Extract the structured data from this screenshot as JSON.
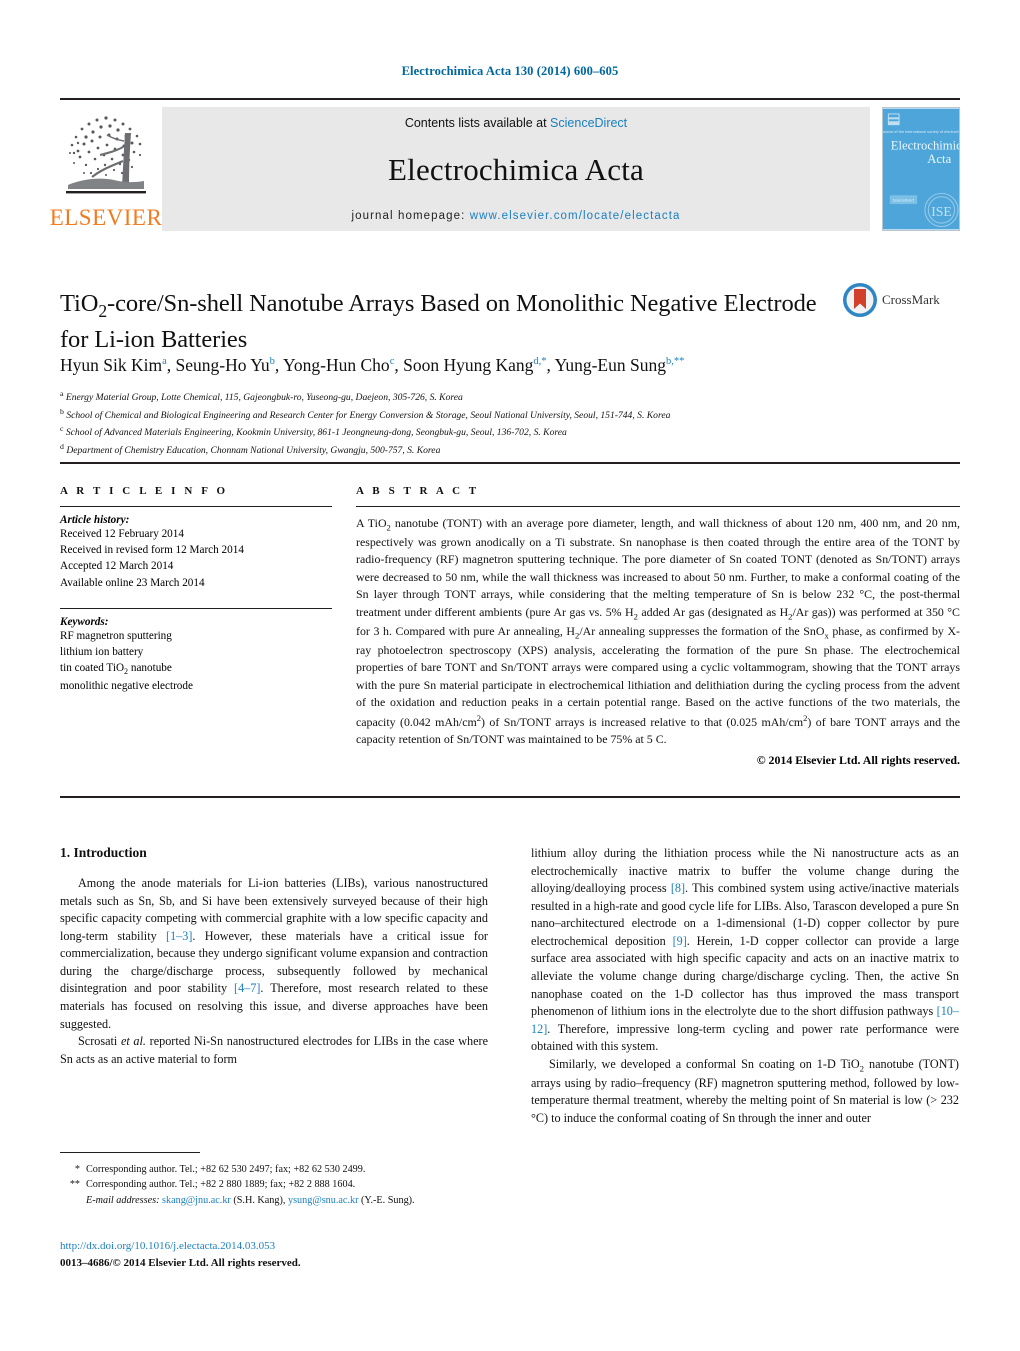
{
  "running_head": "Electrochimica Acta 130 (2014) 600–605",
  "masthead": {
    "contents_prefix": "Contents lists available at ",
    "sciencedirect": "ScienceDirect",
    "journal_title": "Electrochimica Acta",
    "homepage_prefix": "journal homepage: ",
    "homepage_url": "www.elsevier.com/locate/electacta",
    "publisher_wordmark": "ELSEVIER",
    "publisher_logo": "elsevier-tree-icon",
    "cover_logo": "journal-cover-thumbnail",
    "cover_title_line1": "Electrochimica",
    "cover_title_line2": "Acta",
    "accent_link_color": "#1a7fc1",
    "elsevier_orange": "#f07c21",
    "band_color": "#e8e8e8"
  },
  "article": {
    "title": "TiO2-core/Sn-shell Nanotube Arrays Based on Monolithic Negative Electrode for Li-ion Batteries",
    "crossmark_label": "CrossMark",
    "crossmark_icon": "crossmark-icon",
    "authors_plain": "Hyun Sik Kim a, Seung-Ho Yu b, Yong-Hun Cho c, Soon Hyung Kang d,*, Yung-Eun Sung b,**",
    "authors": [
      {
        "name": "Hyun Sik Kim",
        "marks": "a"
      },
      {
        "name": "Seung-Ho Yu",
        "marks": "b"
      },
      {
        "name": "Yong-Hun Cho",
        "marks": "c"
      },
      {
        "name": "Soon Hyung Kang",
        "marks": "d,*"
      },
      {
        "name": "Yung-Eun Sung",
        "marks": "b,**"
      }
    ],
    "affiliations": [
      {
        "mark": "a",
        "text": "Energy Material Group, Lotte Chemical, 115, Gajeongbuk-ro, Yuseong-gu, Daejeon, 305-726, S. Korea"
      },
      {
        "mark": "b",
        "text": "School of Chemical and Biological Engineering and Research Center for Energy Conversion & Storage, Seoul National University, Seoul, 151-744, S. Korea"
      },
      {
        "mark": "c",
        "text": "School of Advanced Materials Engineering, Kookmin University, 861-1 Jeongneung-dong, Seongbuk-gu, Seoul, 136-702, S. Korea"
      },
      {
        "mark": "d",
        "text": "Department of Chemistry Education, Chonnam National University, Gwangju, 500-757, S. Korea"
      }
    ]
  },
  "article_info": {
    "heading": "A R T I C L E   I N F O",
    "history_label": "Article history:",
    "history": [
      "Received 12 February 2014",
      "Received in revised form 12 March 2014",
      "Accepted 12 March 2014",
      "Available online 23 March 2014"
    ],
    "keywords_label": "Keywords:",
    "keywords_plain": [
      "RF magnetron sputtering",
      "lithium ion battery",
      "tin coated TiO2 nanotube",
      "monolithic negative electrode"
    ]
  },
  "abstract": {
    "heading": "A B S T R A C T",
    "text": "A TiO2 nanotube (TONT) with an average pore diameter, length, and wall thickness of about 120 nm, 400 nm, and 20 nm, respectively was grown anodically on a Ti substrate. Sn nanophase is then coated through the entire area of the TONT by radio-frequency (RF) magnetron sputtering technique. The pore diameter of Sn coated TONT (denoted as Sn/TONT) arrays were decreased to 50 nm, while the wall thickness was increased to about 50 nm. Further, to make a conformal coating of the Sn layer through TONT arrays, while considering that the melting temperature of Sn is below 232 °C, the post-thermal treatment under different ambients (pure Ar gas vs. 5% H2 added Ar gas (designated as H2/Ar gas)) was performed at 350 °C for 3 h. Compared with pure Ar annealing, H2/Ar annealing suppresses the formation of the SnOx phase, as confirmed by X-ray photoelectron spectroscopy (XPS) analysis, accelerating the formation of the pure Sn phase. The electrochemical properties of bare TONT and Sn/TONT arrays were compared using a cyclic voltammogram, showing that the TONT arrays with the pure Sn material participate in electrochemical lithiation and delithiation during the cycling process from the advent of the oxidation and reduction peaks in a certain potential range. Based on the active functions of the two materials, the capacity (0.042 mAh/cm2) of Sn/TONT arrays is increased relative to that (0.025 mAh/cm2) of bare TONT arrays and the capacity retention of Sn/TONT was maintained to be 75% at 5 C.",
    "copyright": "© 2014 Elsevier Ltd. All rights reserved."
  },
  "introduction": {
    "heading": "1.  Introduction",
    "left_paragraph_1": "Among the anode materials for Li-ion batteries (LIBs), various nanostructured metals such as Sn, Sb, and Si have been extensively surveyed because of their high specific capacity competing with commercial graphite with a low specific capacity and long-term stability [1–3]. However, these materials have a critical issue for commercialization, because they undergo significant volume expansion and contraction during the charge/discharge process, subsequently followed by mechanical disintegration and poor stability [4–7]. Therefore, most research related to these materials has focused on resolving this issue, and diverse approaches have been suggested.",
    "left_paragraph_2": "Scrosati et al. reported Ni-Sn nanostructured electrodes for LIBs in the case where Sn acts as an active material to form",
    "right_paragraph_1": "lithium alloy during the lithiation process while the Ni nanostructure acts as an electrochemically inactive matrix to buffer the volume change during the alloying/dealloying process [8]. This combined system using active/inactive materials resulted in a high-rate and good cycle life for LIBs. Also, Tarascon developed a pure Sn nano–architectured electrode on a 1-dimensional (1-D) copper collector by pure electrochemical deposition [9]. Herein, 1-D copper collector can provide a large surface area associated with high specific capacity and acts on an inactive matrix to alleviate the volume change during charge/discharge cycling. Then, the active Sn nanophase coated on the 1-D collector has thus improved the mass transport phenomenon of lithium ions in the electrolyte due to the short diffusion pathways [10–12]. Therefore, impressive long-term cycling and power rate performance were obtained with this system.",
    "right_paragraph_2": "Similarly, we developed a conformal Sn coating on 1-D TiO2 nanotube (TONT) arrays using by radio–frequency (RF) magnetron sputtering method, followed by low-temperature thermal treatment, whereby the melting point of Sn material is low (> 232 °C) to induce the conformal coating of Sn through the inner and outer"
  },
  "footnotes": {
    "star": "*",
    "star_text": "Corresponding author. Tel.; +82 62 530 2497; fax; +82 62 530 2499.",
    "dstar": "**",
    "dstar_text": "Corresponding author. Tel.; +82 2 880 1889; fax; +82 2 888 1604.",
    "email_label": "E-mail addresses:",
    "email_1": "skang@jnu.ac.kr",
    "email_1_person": "(S.H. Kang),",
    "email_2": "ysung@snu.ac.kr",
    "email_2_person": "(Y.-E. Sung)."
  },
  "doi_block": {
    "doi_url": "http://dx.doi.org/10.1016/j.electacta.2014.03.053",
    "issn_line": "0013–4686/© 2014 Elsevier Ltd. All rights reserved."
  }
}
